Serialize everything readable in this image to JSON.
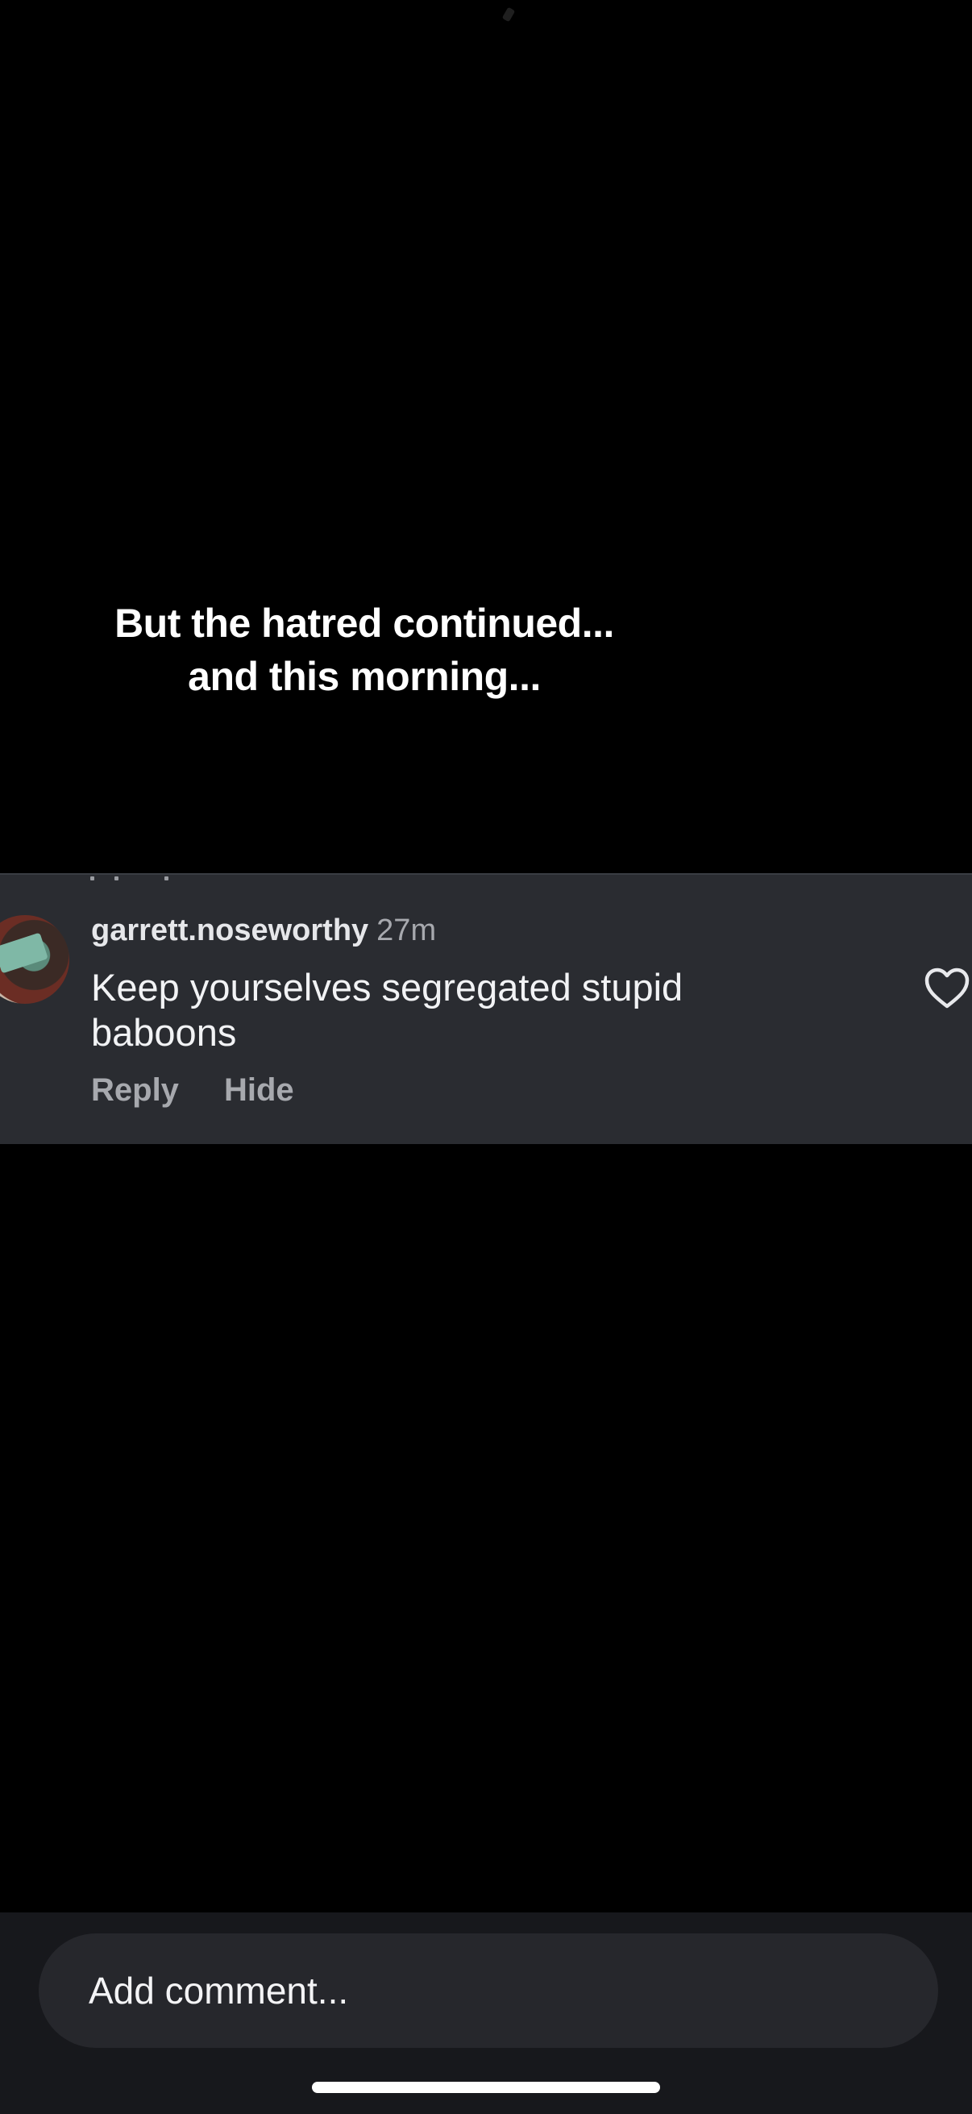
{
  "video": {
    "caption_line1": "But the hatred continued...",
    "caption_line2": "and this morning..."
  },
  "comment": {
    "username": "garrett.noseworthy",
    "timestamp": "27m",
    "text": "Keep yourselves segregated stupid baboons",
    "reply_label": "Reply",
    "hide_label": "Hide",
    "like_icon": "heart-outline-icon"
  },
  "composer": {
    "placeholder": "Add comment..."
  },
  "colors": {
    "background": "#000000",
    "comment_card": "#2a2c31",
    "bottom_bar": "#17181c",
    "input_bg": "#26272c",
    "muted_text": "#a7a9ae"
  }
}
